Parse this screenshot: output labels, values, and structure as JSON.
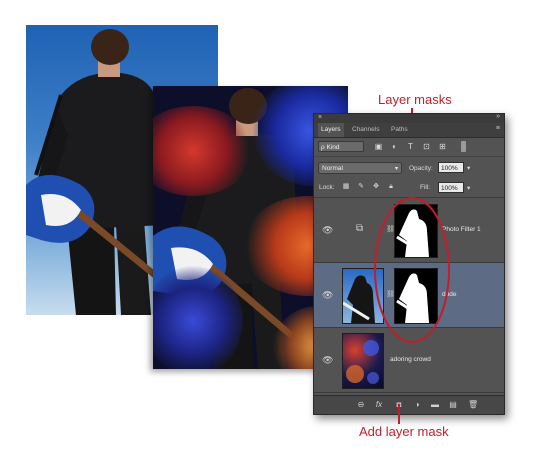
{
  "callouts": {
    "layer_masks": "Layer masks",
    "add_layer_mask": "Add layer mask"
  },
  "colors": {
    "callout": "#c41d2a",
    "panel_bg": "#535353",
    "selected_layer": "#5d6b85"
  },
  "panel": {
    "close_glyph": "×",
    "collapse_glyph": "»",
    "menu_glyph": "≡",
    "tabs": [
      {
        "label": "Layers",
        "active": true
      },
      {
        "label": "Channels",
        "active": false
      },
      {
        "label": "Paths",
        "active": false
      }
    ],
    "filter": {
      "kind_label": "ρ Kind",
      "icons": [
        "image-filter-icon",
        "adjustment-filter-icon",
        "type-filter-icon",
        "shape-filter-icon",
        "smart-object-filter-icon"
      ]
    },
    "blend_mode": "Normal",
    "opacity_label": "Opacity:",
    "opacity_value": "100%",
    "lock_label": "Lock:",
    "fill_label": "Fill:",
    "fill_value": "100%",
    "layers": [
      {
        "name": "Photo Filter 1",
        "type": "adjustment",
        "visible": true,
        "selected": false
      },
      {
        "name": "dude",
        "type": "pixel",
        "visible": true,
        "selected": true
      },
      {
        "name": "adoring crowd",
        "type": "pixel",
        "visible": true,
        "selected": false
      }
    ],
    "bottom_icons": [
      "link-layers-icon",
      "fx-icon",
      "add-layer-mask-icon",
      "new-adjustment-layer-icon",
      "new-group-icon",
      "new-layer-icon",
      "trash-icon"
    ],
    "fx_label": "fx"
  }
}
